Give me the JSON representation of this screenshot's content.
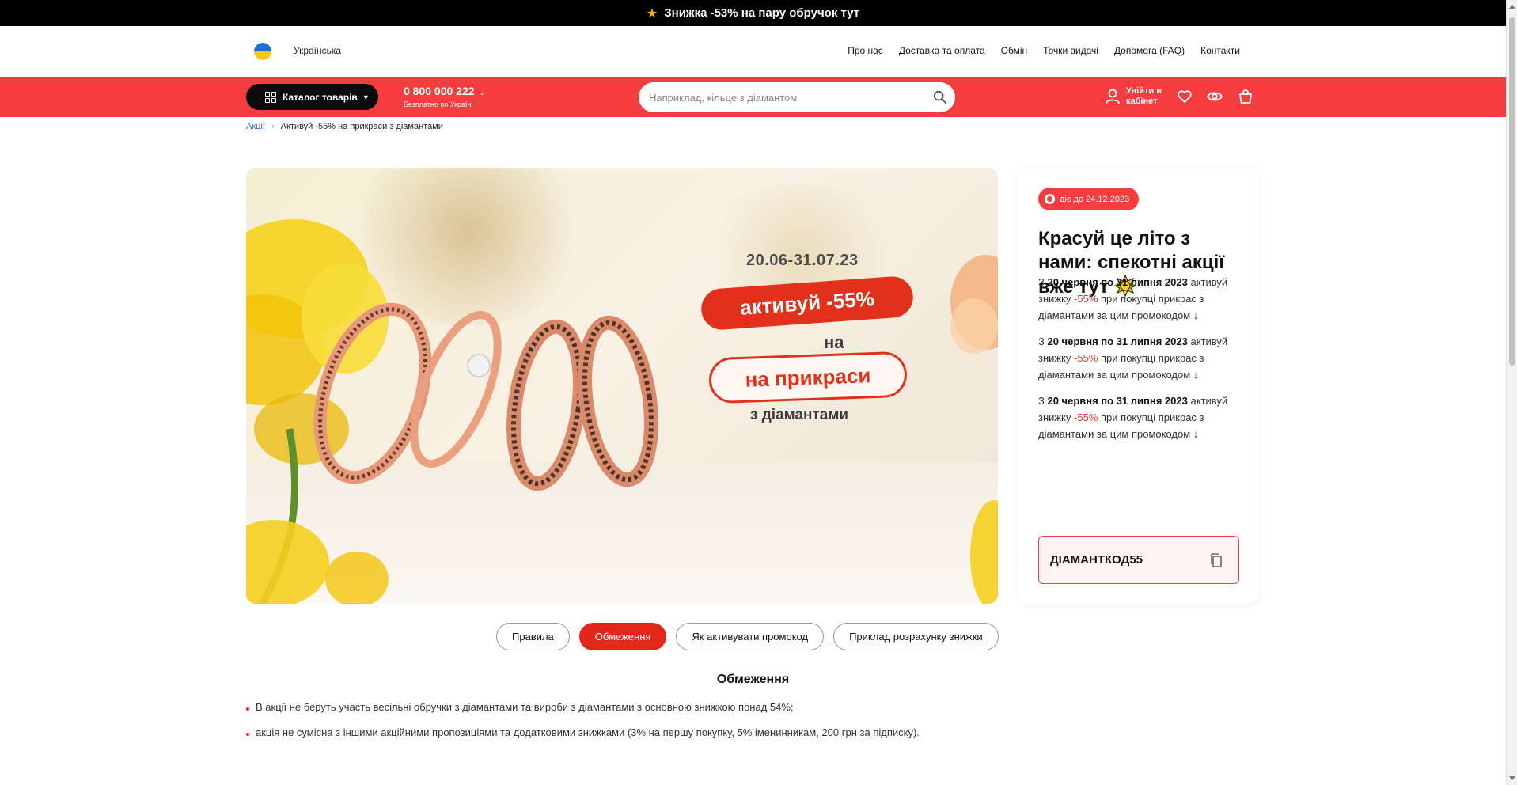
{
  "top_promo": {
    "icon": "star-icon",
    "text": "Знижка -53% на пару обручок тут"
  },
  "header": {
    "language": "Українська",
    "links": [
      "Про нас",
      "Доставка та оплата",
      "Обмін",
      "Точки видачі",
      "Допомога (FAQ)",
      "Контакти"
    ],
    "catalog_label": "Каталог товарів",
    "phone": "0 800 000 222",
    "phone_note": "Безплатно по Україні",
    "search_placeholder": "Наприклад, кільце з діамантом",
    "account_label_1": "Увійти в",
    "account_label_2": "кабінет"
  },
  "breadcrumb": {
    "parent": "Акції",
    "current": "Активуй -55% на прикраси з діамантами"
  },
  "banner": {
    "date": "20.06-31.07.23",
    "headline": "активуй -55%",
    "connector": "на",
    "subject": "на прикраси",
    "subtitle": "з діамантами"
  },
  "offer": {
    "badge": "діє до 24.12.2023",
    "title": "Красуй це літо з нами: спекотні акції вже тут",
    "paragraphs": [
      {
        "prefix": "З ",
        "dates": "20 червня по 31 липня 2023",
        "mid": " активуй знижку ",
        "discount": "-55%",
        "suffix": " при покупці прикрас з діамантами за цим промокодом ↓"
      },
      {
        "prefix": "З ",
        "dates": "20 червня по 31 липня 2023",
        "mid": " активуй знижку ",
        "discount": "-55%",
        "suffix": " при покупці прикрас з діамантами за цим промокодом ↓"
      },
      {
        "prefix": "З ",
        "dates": "20 червня по 31 липня 2023",
        "mid": " активуй знижку ",
        "discount": "-55%",
        "suffix": " при покупці прикрас з діамантами за цим промокодом ↓"
      }
    ],
    "promo_code": "ДІАМАНТКОД55"
  },
  "tabs": [
    {
      "label": "Правила",
      "active": false
    },
    {
      "label": "Обмеження",
      "active": true
    },
    {
      "label": "Як активувати промокод",
      "active": false
    },
    {
      "label": "Приклад розрахунку знижки",
      "active": false
    }
  ],
  "restrictions": {
    "title": "Обмеження",
    "items": [
      "В акції не беруть участь весільні обручки з діамантами та вироби з діамантами з основною знижкою понад 54%;",
      "акція не сумісна з іншими акційними пропозиціями та додатковими знижками (3% на першу покупку, 5% іменинникам, 200 грн за підписку)."
    ]
  },
  "colors": {
    "accent": "#f53d3f",
    "tab_active": "#e3281a",
    "promo_bar": "#000000"
  }
}
